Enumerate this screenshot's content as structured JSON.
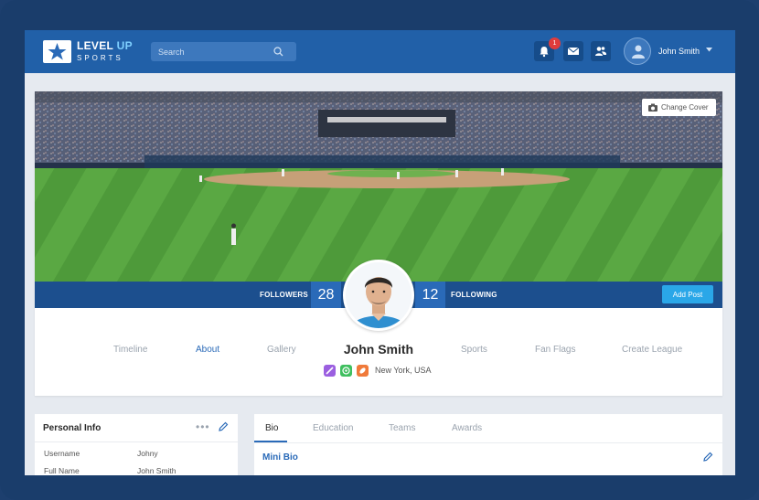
{
  "brand": {
    "name_main": "LEVEL",
    "name_accent": "UP",
    "sub": "SPORTS"
  },
  "search": {
    "placeholder": "Search"
  },
  "notifications": {
    "count": "1"
  },
  "user": {
    "name": "John Smith"
  },
  "cover": {
    "change_label": "Change Cover"
  },
  "stats": {
    "followers_label": "FOLLOWERS",
    "followers_count": "28",
    "following_count": "12",
    "following_label": "FOLLOWING"
  },
  "actions": {
    "add_post": "Add Post"
  },
  "profile": {
    "name": "John Smith",
    "location": "New York, USA",
    "tabs": [
      "Timeline",
      "About",
      "Gallery",
      "Sports",
      "Fan Flags",
      "Create League"
    ],
    "active_tab": "About"
  },
  "personal_info": {
    "title": "Personal Info",
    "rows": [
      {
        "label": "Username",
        "value": "Johny"
      },
      {
        "label": "Full Name",
        "value": "John  Smith"
      }
    ]
  },
  "bio_card": {
    "tabs": [
      "Bio",
      "Education",
      "Teams",
      "Awards"
    ],
    "active_tab": "Bio",
    "section_title": "Mini Bio"
  },
  "colors": {
    "topbar": "#2160a8",
    "accent": "#2a6ab8",
    "add_post": "#2aa7e8",
    "badge": "#e03c3c"
  }
}
